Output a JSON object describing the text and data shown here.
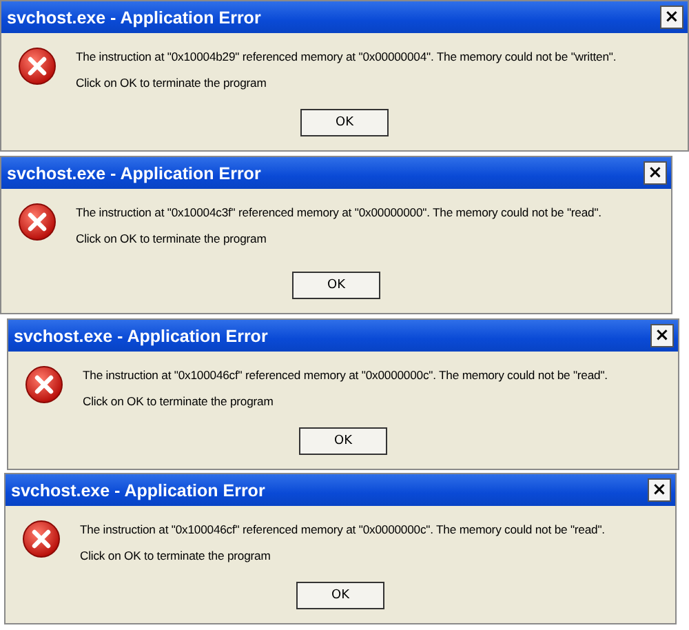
{
  "dialogs": [
    {
      "title": "svchost.exe - Application Error",
      "close": "×",
      "message": "The instruction at \"0x10004b29\" referenced memory at \"0x00000004\". The memory could not be \"written\".",
      "hint": "Click on OK to terminate the program",
      "button": "OK"
    },
    {
      "title": "svchost.exe - Application Error",
      "close": "×",
      "message": "The instruction at \"0x10004c3f\" referenced memory at \"0x00000000\". The memory could not be \"read\".",
      "hint": "Click on OK to terminate the program",
      "button": "OK"
    },
    {
      "title": "svchost.exe - Application Error",
      "close": "×",
      "message": "The instruction at \"0x100046cf\" referenced memory at \"0x0000000c\". The memory could not be \"read\".",
      "hint": "Click on OK to terminate the program",
      "button": "OK"
    },
    {
      "title": "svchost.exe - Application Error",
      "close": "×",
      "message": "The instruction at \"0x100046cf\" referenced memory at \"0x0000000c\". The memory could not be \"read\".",
      "hint": "Click on OK to terminate the program",
      "button": "OK"
    }
  ]
}
